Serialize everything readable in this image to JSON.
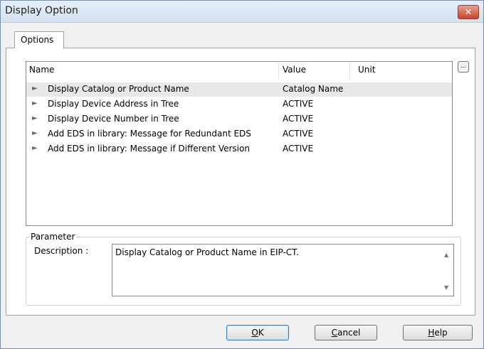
{
  "window": {
    "title": "Display Option",
    "close": "✕"
  },
  "tabs": [
    {
      "label": "Options"
    }
  ],
  "list": {
    "columns": {
      "name": "Name",
      "value": "Value",
      "unit": "Unit"
    },
    "rows": [
      {
        "name": "Display Catalog or Product Name",
        "value": "Catalog Name",
        "unit": ""
      },
      {
        "name": "Display Device Address in Tree",
        "value": "ACTIVE",
        "unit": ""
      },
      {
        "name": "Display Device Number in Tree",
        "value": "ACTIVE",
        "unit": ""
      },
      {
        "name": "Add EDS in library: Message for Redundant EDS",
        "value": "ACTIVE",
        "unit": ""
      },
      {
        "name": "Add EDS in library: Message if Different Version",
        "value": "ACTIVE",
        "unit": ""
      }
    ],
    "selected_index": 0,
    "ellipsis": "..."
  },
  "parameter": {
    "legend": "Parameter",
    "description_label": "Description :",
    "description": "Display Catalog or Product Name in EIP-CT."
  },
  "buttons": {
    "ok": {
      "accel": "O",
      "rest": "K"
    },
    "cancel": {
      "accel": "C",
      "rest": "ancel"
    },
    "help": {
      "accel": "H",
      "rest": "elp"
    }
  }
}
